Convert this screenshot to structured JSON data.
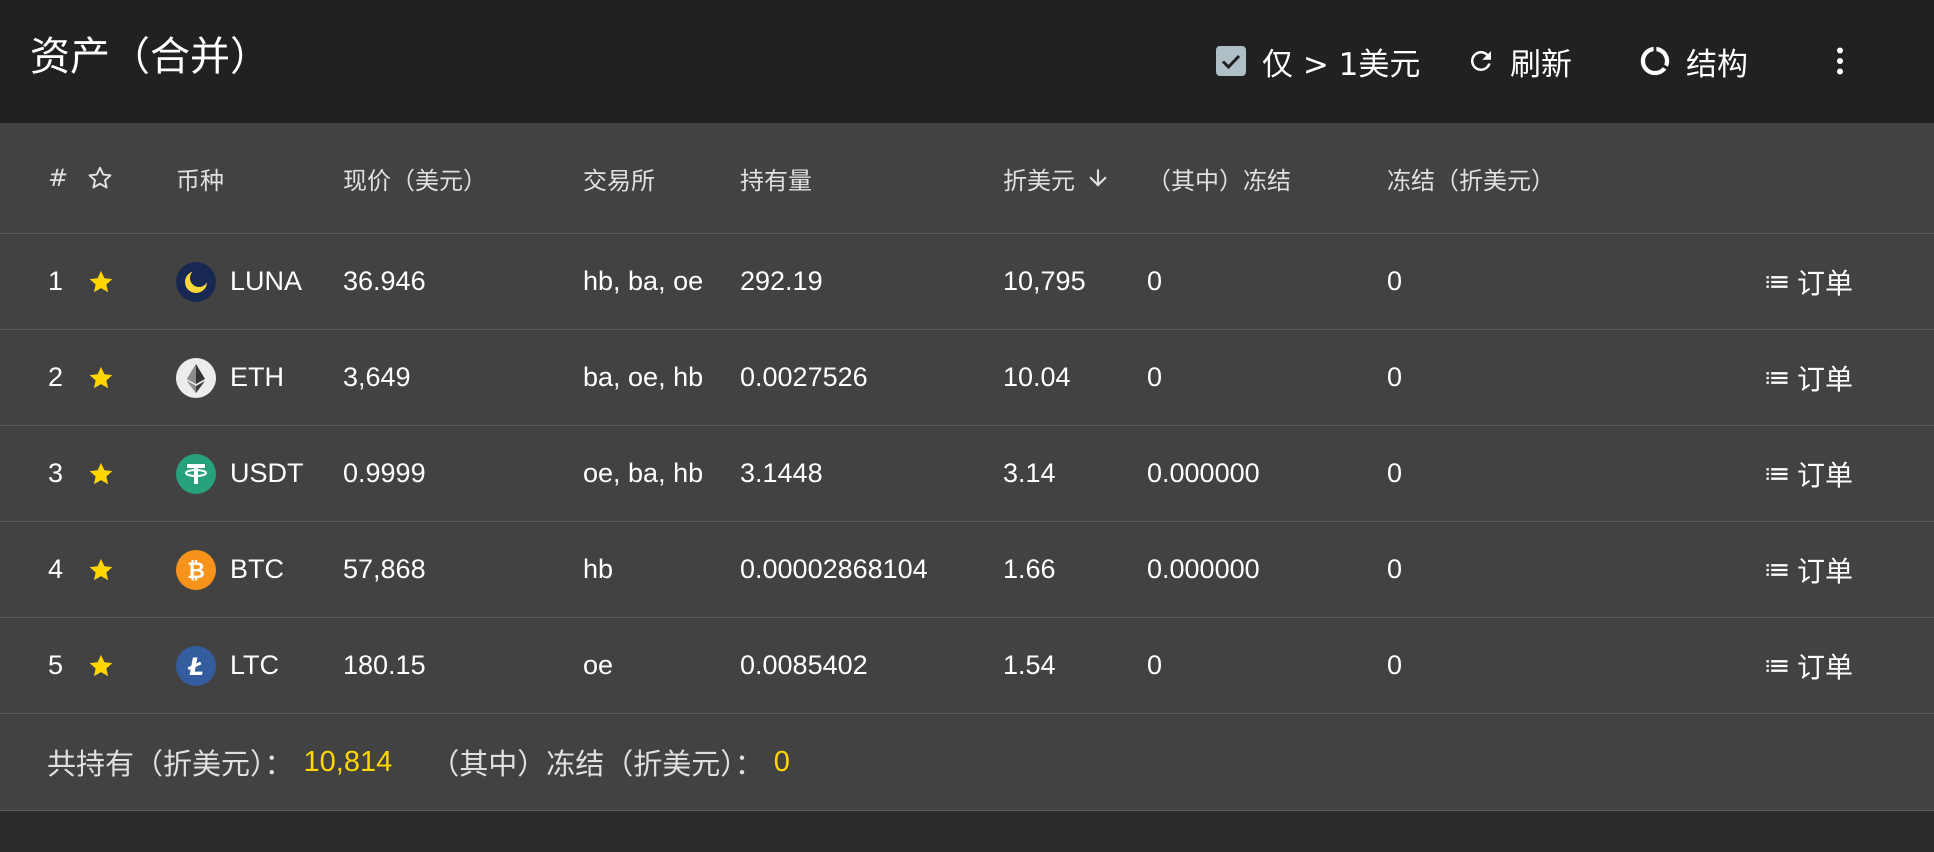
{
  "appbar": {
    "title": "资产（合并）",
    "filter_label": "仅 > 1美元",
    "filter_checked": true,
    "refresh_label": "刷新",
    "structure_label": "结构"
  },
  "table": {
    "headers": {
      "index": "#",
      "coin": "币种",
      "price": "现价（美元）",
      "exchange": "交易所",
      "holding": "持有量",
      "usd_value": "折美元",
      "frozen": "（其中）冻结",
      "frozen_usd": "冻结（折美元）"
    },
    "sort_column": "usd_value",
    "sort_direction": "descending",
    "rows": [
      {
        "index": "1",
        "starred": true,
        "coin": "LUNA",
        "icon": "luna-icon",
        "price": "36.946",
        "exchange": "hb, ba, oe",
        "holding": "292.19",
        "usd_value": "10,795",
        "frozen": "0",
        "frozen_usd": "0",
        "orders_label": "订单"
      },
      {
        "index": "2",
        "starred": true,
        "coin": "ETH",
        "icon": "eth-icon",
        "price": "3,649",
        "exchange": "ba, oe, hb",
        "holding": "0.0027526",
        "usd_value": "10.04",
        "frozen": "0",
        "frozen_usd": "0",
        "orders_label": "订单"
      },
      {
        "index": "3",
        "starred": true,
        "coin": "USDT",
        "icon": "usdt-icon",
        "price": "0.9999",
        "exchange": "oe, ba, hb",
        "holding": "3.1448",
        "usd_value": "3.14",
        "frozen": "0.000000",
        "frozen_usd": "0",
        "orders_label": "订单"
      },
      {
        "index": "4",
        "starred": true,
        "coin": "BTC",
        "icon": "btc-icon",
        "price": "57,868",
        "exchange": "hb",
        "holding": "0.00002868104",
        "usd_value": "1.66",
        "frozen": "0.000000",
        "frozen_usd": "0",
        "orders_label": "订单"
      },
      {
        "index": "5",
        "starred": true,
        "coin": "LTC",
        "icon": "ltc-icon",
        "price": "180.15",
        "exchange": "oe",
        "holding": "0.0085402",
        "usd_value": "1.54",
        "frozen": "0",
        "frozen_usd": "0",
        "orders_label": "订单"
      }
    ]
  },
  "footer": {
    "total_label": "共持有（折美元）：",
    "total_value": "10,814",
    "frozen_label": "（其中）冻结（折美元）：",
    "frozen_value": "0"
  },
  "colors": {
    "appbar_bg": "#212121",
    "table_bg": "#424242",
    "star": "#ffd600",
    "summary_value": "#ffd600"
  }
}
